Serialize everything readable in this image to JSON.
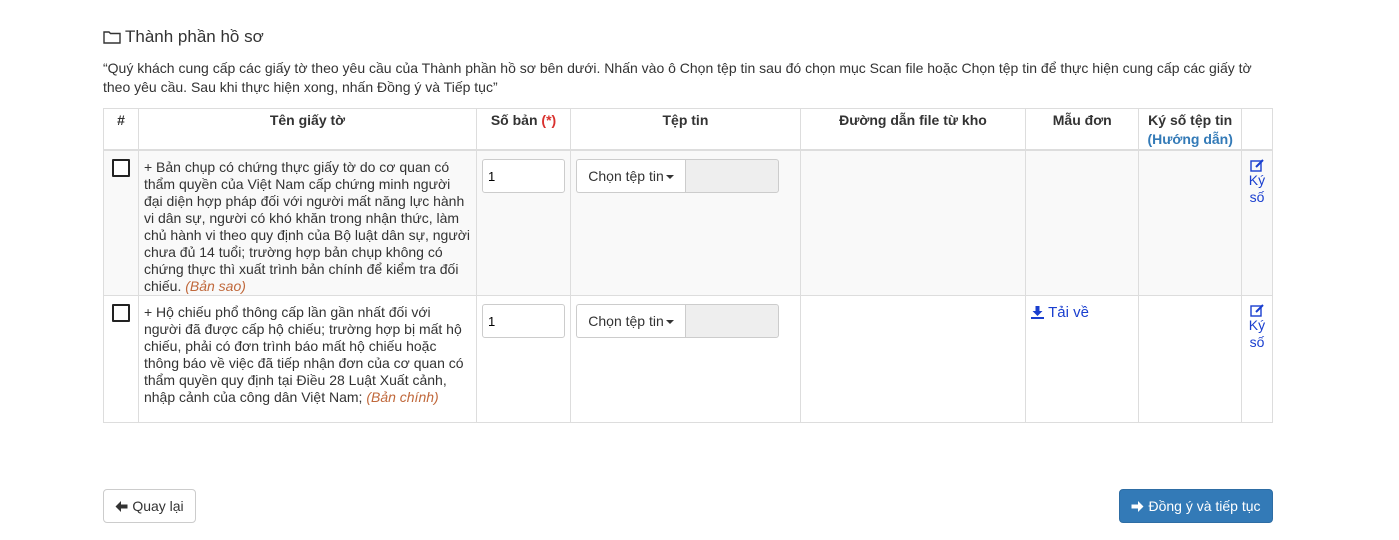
{
  "section": {
    "title": "Thành phần hồ sơ",
    "intro": "“Quý khách cung cấp các giấy tờ theo yêu cầu của Thành phần hồ sơ bên dưới. Nhấn vào ô Chọn tệp tin sau đó chọn mục Scan file hoặc Chọn tệp tin để thực hiện cung cấp các giấy tờ theo yêu cầu. Sau khi thực hiện xong, nhấn Đồng ý và Tiếp tục”"
  },
  "table": {
    "headers": {
      "index": "#",
      "name": "Tên giấy tờ",
      "qty": "Số bản",
      "qty_required": "(*)",
      "file": "Tệp tin",
      "path": "Đường dẫn file từ kho",
      "form": "Mẫu đơn",
      "sign": "Ký số tệp tin",
      "sign_guide": "(Hướng dẫn)"
    },
    "rows": [
      {
        "name": "+ Bản chụp có chứng thực giấy tờ do cơ quan có thẩm quyền của Việt Nam cấp chứng minh người đại diện hợp pháp đối với người mất năng lực hành vi dân sự, người có khó khăn trong nhận thức, làm chủ hành vi theo quy định của Bộ luật dân sự, người chưa đủ 14 tuổi; trường hợp bản chụp không có chứng thực thì xuất trình bản chính để kiểm tra đối chiếu.",
        "copy_type": "(Bản sao)",
        "qty": "1",
        "file_button": "Chọn tệp tin",
        "form_link": "",
        "sign_link": "Ký số"
      },
      {
        "name": "+ Hộ chiếu phổ thông cấp lần gần nhất đối với người đã được cấp hộ chiếu; trường hợp bị mất hộ chiếu, phải có đơn trình báo mất hộ chiếu hoặc thông báo về việc đã tiếp nhận đơn của cơ quan có thẩm quyền quy định tại Điều 28 Luật Xuất cảnh, nhập cảnh của công dân Việt Nam;",
        "copy_type": "(Bản chính)",
        "qty": "1",
        "file_button": "Chọn tệp tin",
        "form_link": "Tải về",
        "sign_link": "Ký số"
      }
    ]
  },
  "buttons": {
    "back": "Quay lại",
    "next": "Đồng ý và tiếp tục"
  },
  "colors": {
    "primary": "#337ab7",
    "link": "#1a3fcf",
    "required": "#d9312e",
    "copy_type": "#c0683b"
  }
}
